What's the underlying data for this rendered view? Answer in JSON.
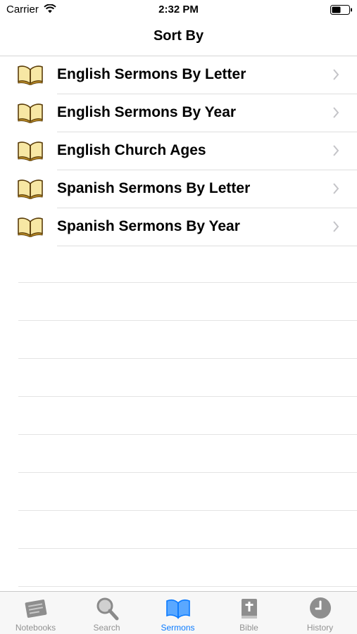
{
  "status_bar": {
    "carrier": "Carrier",
    "time": "2:32 PM"
  },
  "nav": {
    "title": "Sort By"
  },
  "list": {
    "items": [
      {
        "label": "English Sermons By Letter",
        "icon": "book-icon"
      },
      {
        "label": "English Sermons By Year",
        "icon": "book-icon"
      },
      {
        "label": "English Church Ages",
        "icon": "book-icon"
      },
      {
        "label": "Spanish Sermons By Letter",
        "icon": "book-icon"
      },
      {
        "label": "Spanish Sermons By Year",
        "icon": "book-icon"
      }
    ]
  },
  "tab_bar": {
    "active_color": "#0a7aff",
    "inactive_color": "#929292",
    "tabs": [
      {
        "label": "Notebooks",
        "icon": "notebook-icon",
        "active": false
      },
      {
        "label": "Search",
        "icon": "magnifier-icon",
        "active": false
      },
      {
        "label": "Sermons",
        "icon": "open-book-icon",
        "active": true
      },
      {
        "label": "Bible",
        "icon": "bible-icon",
        "active": false
      },
      {
        "label": "History",
        "icon": "clock-icon",
        "active": false
      }
    ]
  }
}
